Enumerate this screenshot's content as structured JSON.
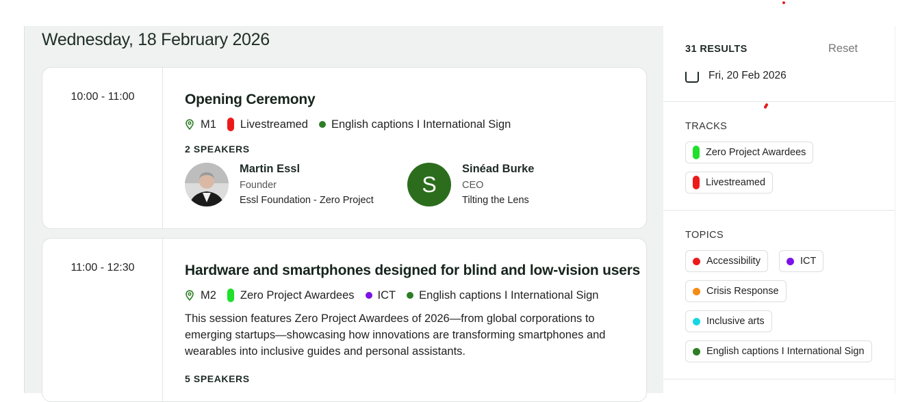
{
  "date_heading": "Wednesday, 18 February 2026",
  "colors": {
    "green": "#1fe02a",
    "red": "#ec1a1a",
    "purple": "#7b12e6",
    "orange": "#f58a14",
    "cyan": "#17d6e3",
    "dark_green": "#2e7d26",
    "avatar_green": "#2c6d1d"
  },
  "sessions": [
    {
      "time": "10:00 - 11:00",
      "title": "Opening Ceremony",
      "location": "M1",
      "tags": [
        {
          "label": "Livestreamed",
          "shape": "pill",
          "color": "#ec1a1a"
        },
        {
          "label": "English captions I International Sign",
          "shape": "dot",
          "color": "#2e7d26"
        }
      ],
      "speakers_label": "2 SPEAKERS",
      "speakers": [
        {
          "name": "Martin Essl",
          "role": "Founder",
          "org": "Essl Foundation - Zero Project",
          "avatar": "photo"
        },
        {
          "name": "Sinéad Burke",
          "role": "CEO",
          "org": "Tilting the Lens",
          "avatar_letter": "S"
        }
      ]
    },
    {
      "time": "11:00 - 12:30",
      "title": "Hardware and smartphones designed for blind and low-vision users",
      "location": "M2",
      "tags": [
        {
          "label": "Zero Project Awardees",
          "shape": "pill",
          "color": "#1fe02a"
        },
        {
          "label": "ICT",
          "shape": "dot",
          "color": "#7b12e6"
        },
        {
          "label": "English captions I International Sign",
          "shape": "dot",
          "color": "#2e7d26"
        }
      ],
      "description": "This session features Zero Project Awardees of 2026—from global corporations to emerging startups—showcasing how innovations are transforming smartphones and wearables into inclusive guides and personal assistants.",
      "speakers_label": "5 SPEAKERS"
    }
  ],
  "sidebar": {
    "results": "31 RESULTS",
    "reset": "Reset",
    "date_option": "Fri, 20 Feb 2026",
    "tracks_label": "TRACKS",
    "tracks": [
      {
        "label": "Zero Project Awardees",
        "color": "#1fe02a"
      },
      {
        "label": "Livestreamed",
        "color": "#ec1a1a"
      }
    ],
    "topics_label": "TOPICS",
    "topics": [
      {
        "label": "Accessibility",
        "color": "#ec1a1a"
      },
      {
        "label": "ICT",
        "color": "#7b12e6"
      },
      {
        "label": "Crisis Response",
        "color": "#f58a14"
      },
      {
        "label": "Inclusive arts",
        "color": "#17d6e3"
      },
      {
        "label": "English captions I International Sign",
        "color": "#2e7d26"
      }
    ]
  }
}
